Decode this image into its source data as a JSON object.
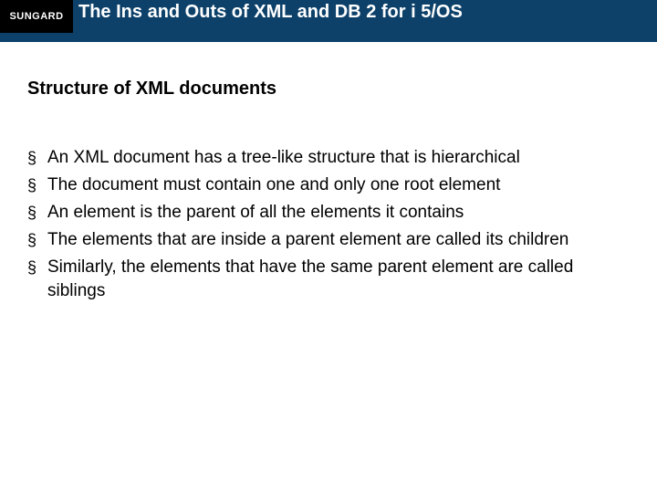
{
  "header": {
    "logo": "SUNGARD",
    "title": "The Ins and Outs of XML and DB 2 for i 5/OS"
  },
  "subtitle": "Structure of XML documents",
  "bullets": [
    "An XML document has a tree-like structure that is hierarchical",
    "The document must contain one and only one root element",
    "An element is the parent of all the elements it contains",
    "The elements that are inside a parent element are called its children",
    "Similarly, the elements that have the same parent element are called siblings"
  ]
}
